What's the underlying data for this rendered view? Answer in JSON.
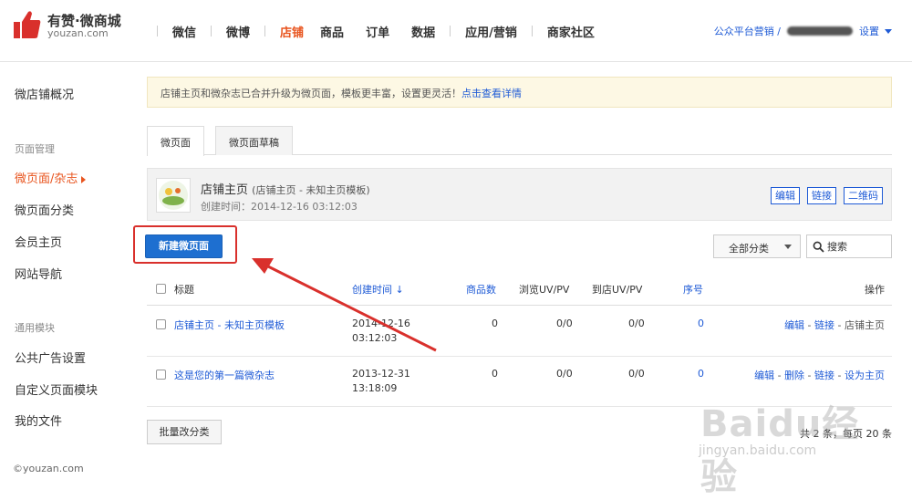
{
  "header": {
    "logo_title": "有赞·微商城",
    "logo_sub": "youzan.com",
    "nav": [
      "微信",
      "微博",
      "店铺",
      "商品",
      "订单",
      "数据",
      "应用/营销",
      "商家社区"
    ],
    "active_nav": "店铺",
    "account_prefix": "公众平台营销 /",
    "settings_label": "设置"
  },
  "sidebar": {
    "overview": "微店铺概况",
    "group_pages": "页面管理",
    "pages_magazine": "微页面/杂志",
    "page_category": "微页面分类",
    "member_home": "会员主页",
    "site_nav": "网站导航",
    "group_common": "通用模块",
    "common_ads": "公共广告设置",
    "custom_module": "自定义页面模块",
    "my_files": "我的文件",
    "copyright": "©youzan.com"
  },
  "notice": {
    "text": "店铺主页和微杂志已合并升级为微页面，模板更丰富，设置更灵活！",
    "link": "点击查看详情"
  },
  "tabs": [
    "微页面",
    "微页面草稿"
  ],
  "home_card": {
    "title": "店铺主页",
    "subtitle": "(店铺主页 - 未知主页模板)",
    "created": "创建时间：2014-12-16 03:12:03",
    "btn_edit": "编辑",
    "btn_link": "链接",
    "btn_qr": "二维码"
  },
  "toolbar": {
    "new_page": "新建微页面",
    "filter": "全部分类",
    "search_placeholder": "搜索"
  },
  "table": {
    "headers": {
      "title": "标题",
      "created": "创建时间 ↓",
      "goods": "商品数",
      "uv_pv": "浏览UV/PV",
      "store_uv_pv": "到店UV/PV",
      "order": "序号",
      "ops": "操作"
    },
    "rows": [
      {
        "title": "店铺主页 - 未知主页模板",
        "date": "2014-12-16",
        "time": "03:12:03",
        "goods": "0",
        "uv_pv": "0/0",
        "store_uv_pv": "0/0",
        "order": "0",
        "ops": [
          "编辑",
          "链接",
          "店铺主页"
        ]
      },
      {
        "title": "这是您的第一篇微杂志",
        "date": "2013-12-31",
        "time": "13:18:09",
        "goods": "0",
        "uv_pv": "0/0",
        "store_uv_pv": "0/0",
        "order": "0",
        "ops": [
          "编辑",
          "删除",
          "链接",
          "设为主页"
        ]
      }
    ]
  },
  "footer": {
    "batch": "批量改分类",
    "paging": "共 2 条，每页 20 条"
  },
  "watermark": {
    "text": "Baidu经验",
    "sub": "jingyan.baidu.com"
  },
  "colors": {
    "accent": "#e8541e",
    "link": "#1f5bd6",
    "primary_button": "#1e6fd0",
    "annotation": "#d9302c"
  }
}
